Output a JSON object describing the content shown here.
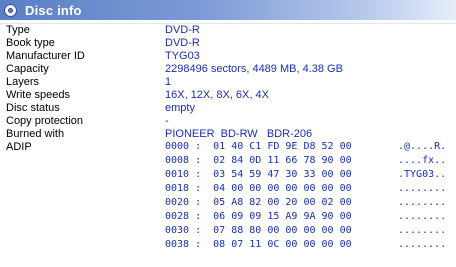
{
  "window": {
    "title": "Disc info"
  },
  "fields": [
    {
      "label": "Type",
      "value": "DVD-R"
    },
    {
      "label": "Book type",
      "value": "DVD-R"
    },
    {
      "label": "Manufacturer ID",
      "value": "TYG03"
    },
    {
      "label": "Capacity",
      "value": "2298496 sectors, 4489 MB, 4.38 GB"
    },
    {
      "label": "Layers",
      "value": "1"
    },
    {
      "label": "Write speeds",
      "value": "16X, 12X, 8X, 6X, 4X"
    },
    {
      "label": "Disc status",
      "value": "empty"
    },
    {
      "label": "Copy protection",
      "value": "-"
    },
    {
      "label": "Burned with",
      "value": "PIONEER  BD-RW   BDR-206"
    }
  ],
  "adip": {
    "label": "ADIP",
    "rows": [
      {
        "hex": "0000 :  01 40 C1 FD 9E D8 52 00",
        "ascii": ".@....R."
      },
      {
        "hex": "0008 :  02 84 0D 11 66 78 90 00",
        "ascii": "....fx.."
      },
      {
        "hex": "0010 :  03 54 59 47 30 33 00 00",
        "ascii": ".TYG03.."
      },
      {
        "hex": "0018 :  04 00 00 00 00 00 00 00",
        "ascii": "........"
      },
      {
        "hex": "0020 :  05 A8 82 00 20 00 02 00",
        "ascii": "........"
      },
      {
        "hex": "0028 :  06 09 09 15 A9 9A 90 00",
        "ascii": "........"
      },
      {
        "hex": "0030 :  07 88 80 00 00 00 00 00",
        "ascii": "........"
      },
      {
        "hex": "0038 :  08 07 11 0C 00 00 00 00",
        "ascii": "........"
      }
    ]
  }
}
